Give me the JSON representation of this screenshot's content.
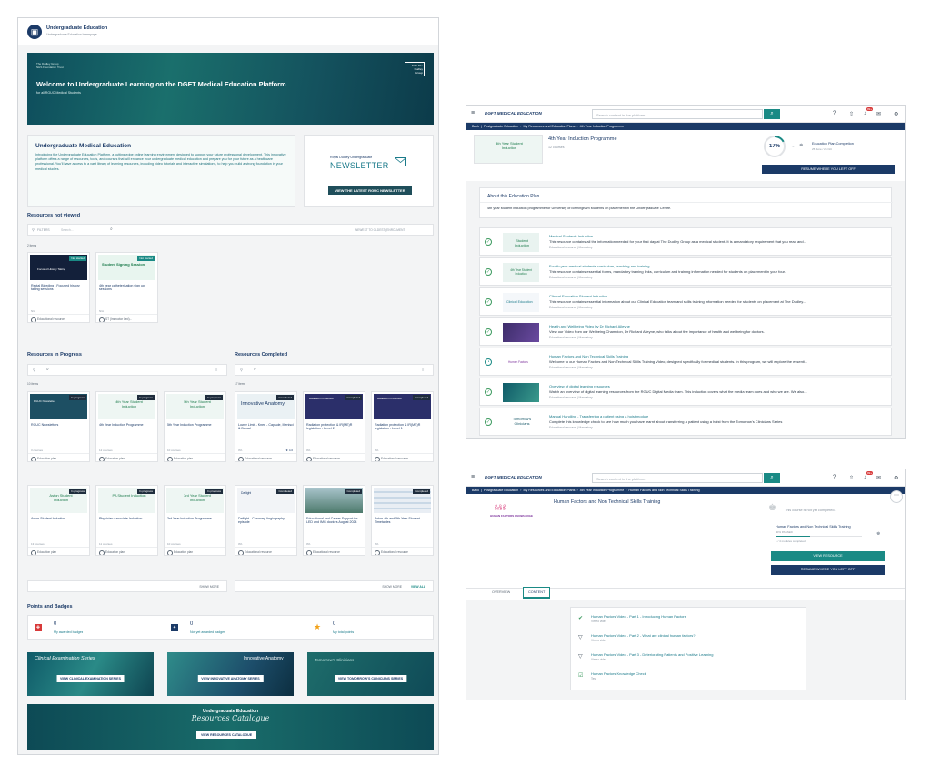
{
  "colors": {
    "navy": "#1b3a67",
    "teal": "#1a8a85",
    "dark_teal": "#1f4e5a",
    "bg": "#f3f4f5"
  },
  "panel1": {
    "app_title": "Undergraduate Education",
    "app_subtitle": "Undergraduate Education homepage",
    "banner": {
      "logo_text": "The Dudley Group NHS Foundation Trust",
      "badge_text": "NHS The Dudley Group",
      "title": "Welcome to Undergraduate Learning on the DGFT Medical Education Platform",
      "subtitle": "for all RGUC Medical Students"
    },
    "intro": {
      "title": "Undergraduate Medical Education",
      "body": "Introducing the Undergraduate Education Platform, a cutting-edge online learning environment designed to support your future professional development. This innovative platform offers a range of resources, tools, and courses that will enhance your undergraduate medical education and prepare you for your future as a healthcare professional. You'll have access to a vast library of learning resources, including video tutorials and interactive simulations, to help you build a strong foundation in your medical studies."
    },
    "newsletter": {
      "small": "Royal Dudley Undergraduate",
      "big": "NEWSLETTER",
      "button": "VIEW THE LATEST RGUC NEWSLETTER"
    },
    "not_viewed": {
      "title": "Resources not viewed",
      "filters": "FILTERS",
      "search_placeholder": "Search...",
      "sort": "NEWEST TO OLDEST (ENROLMENT)",
      "count": "2 items",
      "items": [
        {
          "title": "Rectal Bleeding - Focused history taking sessions",
          "badge": "Not started",
          "meta": "N/A",
          "type": "Educational resource",
          "img_text": "Focused History Taking"
        },
        {
          "title": "4th year catheterisation sign up sessions",
          "badge": "Not started",
          "meta": "N/A",
          "type": "ST (Instructor Led)...",
          "img_text": "Student Signing Session"
        }
      ]
    },
    "in_progress": {
      "title": "Resources in Progress",
      "count": "10 items",
      "items": [
        {
          "title": "RGUC Newsletters",
          "badge": "In progress",
          "meta": "3 courses",
          "type": "Education plan",
          "img_text": "RGUC Newsletter"
        },
        {
          "title": "4th Year Induction Programme",
          "badge": "In progress",
          "meta": "12 courses",
          "type": "Education plan",
          "img_text": "4th Year Student Induction"
        },
        {
          "title": "5th Year Induction Programme",
          "badge": "In progress",
          "meta": "10 courses",
          "type": "Education plan",
          "img_text": "5th Year Student Induction"
        },
        {
          "title": "Aston Student Induction",
          "badge": "In progress",
          "meta": "13 courses",
          "type": "Education plan",
          "img_text": "Aston Student Induction"
        },
        {
          "title": "Physician Associate Induction",
          "badge": "In progress",
          "meta": "11 courses",
          "type": "Education plan",
          "img_text": "PA Student Induction"
        },
        {
          "title": "3rd Year Induction Programme",
          "badge": "In progress",
          "meta": "10 courses",
          "type": "Education plan",
          "img_text": "3rd Year Student Induction"
        }
      ],
      "show_more": "SHOW MORE"
    },
    "completed": {
      "title": "Resources Completed",
      "count": "17 items",
      "items": [
        {
          "title": "Lower Limb - Knee - Capsule, Menisci & Bursal",
          "badge": "Completed",
          "meta": "0%",
          "rating": "4.0",
          "type": "Educational resource",
          "img_text": "Innovative Anatomy"
        },
        {
          "title": "Radiation protection & IR(ME)R legislation - Level 2",
          "badge": "Completed",
          "meta": "0%",
          "type": "Educational resource",
          "img_text": "Radiation Protection"
        },
        {
          "title": "Radiation protection & IR(ME)R legislation - Level 1",
          "badge": "Completed",
          "meta": "0%",
          "type": "Educational resource",
          "img_text": "Radiation Protection"
        },
        {
          "title": "Dailight - Coronary Angiography episode",
          "badge": "Completed",
          "meta": "0%",
          "type": "Educational resource",
          "img_text": "Dailight"
        },
        {
          "title": "Educational and Career Support for LED and IMG doctors August 2024",
          "badge": "Completed",
          "meta": "0%",
          "type": "Educational resource",
          "img_text": ""
        },
        {
          "title": "Aston 4th and 5th Year Student Timetables",
          "badge": "Completed",
          "meta": "0%",
          "type": "Educational resource",
          "img_text": ""
        }
      ],
      "show_more": "SHOW MORE",
      "view_all": "VIEW ALL"
    },
    "points": {
      "title": "Points and Badges",
      "items": [
        {
          "value": "0",
          "label": "My awarded badges"
        },
        {
          "value": "0",
          "label": "Not yet awarded badges"
        },
        {
          "value": "0",
          "label": "My total points"
        }
      ]
    },
    "promos": [
      {
        "button": "VIEW CLINICAL EXAMINATION SERIES",
        "text": "Clinical Examination Series"
      },
      {
        "button": "VIEW INNOVATIVE ANATOMY SERIES",
        "text": "Innovative Anatomy"
      },
      {
        "button": "VIEW TOMORROW'S CLINICIANS SERIES",
        "text": "Tomorrow's Clinicians"
      }
    ],
    "catalogue": {
      "title": "Undergraduate Education",
      "script": "Resources Catalogue",
      "button": "VIEW RESOURCES CATALOGUE"
    }
  },
  "panel2": {
    "logo": "DGFT MEDICAL EDUCATION",
    "search_placeholder": "Search content in the platform",
    "notif_count": "99+",
    "breadcrumb": [
      "Back",
      "Postgraduate Education",
      "My Resources and Education Plans",
      "4th Year Induction Programme"
    ],
    "plan": {
      "title": "4th Year Induction Programme",
      "courses": "12 courses",
      "img_text": "4th Year Student Induction",
      "progress": 17,
      "progress_label": "17%",
      "completion_label": "Education Plan Completion",
      "completion_date": "25 June / 26 Oct",
      "resume": "RESUME WHERE YOU LEFT OFF"
    },
    "about": {
      "title": "About this Education Plan",
      "text": "4th year student induction programme for University of Birmingham students on placement in the Undergraduate Centre."
    },
    "items": [
      {
        "title": "Medical Students Induction",
        "desc": "This resource contains all the information needed for your first day at The Dudley Group as a medical student. It is a mandatory requirement that you read and...",
        "meta": "Educational resource | Mandatory",
        "img_text": "Student Induction"
      },
      {
        "title": "Fourth year medical students curriculum, teaching and training",
        "desc": "This resource contains essential forms, mandatory training links, curriculum and training information needed for students on placement in your four.",
        "meta": "Educational resource | Mandatory",
        "img_text": "4th Year Student Induction"
      },
      {
        "title": "Clinical Education Student Induction",
        "desc": "This resource contains essential information about our Clinical Education team and skills training information needed for students on placement at The Dudley...",
        "meta": "Educational resource | Mandatory",
        "img_text": "Clinical Education"
      },
      {
        "title": "Health and Wellbeing Video by Dr Richard Alleyne",
        "desc": "View our Video from our Wellbeing Champion, Dr Richard Alleyne, who talks about the importance of health and wellbeing for doctors.",
        "meta": "Educational resource | Mandatory",
        "img_text": ""
      },
      {
        "title": "Human Factors and Non Technical Skills Training",
        "desc": "Welcome to our Human Factors and Non Technical Skills Training Video, designed specifically for medical students. In this program, we will explore the essenti...",
        "meta": "Educational resource | Mandatory",
        "img_text": "Human Factors"
      },
      {
        "title": "Overview of digital learning resources",
        "desc": "Watch an overview of digital learning resources from the RGUC Digital Media team. This induction covers what the media team does and who we are. We also...",
        "meta": "Educational resource | Mandatory",
        "img_text": ""
      },
      {
        "title": "Manual Handling - Transferring a patient using a hoist module",
        "desc": "Complete this knowledge check to see how much you have learnt about transferring a patient using a hoist from the Tomorrow's Clinicians Series",
        "meta": "Educational resource | Mandatory",
        "img_text": "Tomorrow's Clinicians"
      }
    ]
  },
  "panel3": {
    "breadcrumb": [
      "Back",
      "Postgraduate Education",
      "My Resources and Education Plans",
      "4th Year Induction Programme",
      "Human Factors and Non Technical Skills Training"
    ],
    "title": "Human Factors and Non Technical Skills Training",
    "img_text": "HUMAN FACTORS KNOWLEDGE",
    "not_completed": "This course is not yet completed.",
    "side_title": "Human Factors and Non Technical Skills Training",
    "side_sub": "40% PASSED",
    "side_progress": 40,
    "modules": "1 / 4 modules completed",
    "view_btn": "VIEW RESOURCE",
    "resume_btn": "RESUME WHERE YOU LEFT OFF",
    "tabs": [
      "OVERVIEW",
      "CONTENT"
    ],
    "content": [
      {
        "title": "Human Factors Video - Part 1 - Introducing Human Factors",
        "sub": "Vimeo video",
        "icon": "check"
      },
      {
        "title": "Human Factors Video - Part 2 - What are clinical human factors?",
        "sub": "Vimeo video",
        "icon": "video"
      },
      {
        "title": "Human Factors Video - Part 3 - Deteriorating Patients and Positive Learning",
        "sub": "Vimeo video",
        "icon": "video"
      },
      {
        "title": "Human Factors Knowledge Check",
        "sub": "Test",
        "icon": "check"
      }
    ]
  }
}
